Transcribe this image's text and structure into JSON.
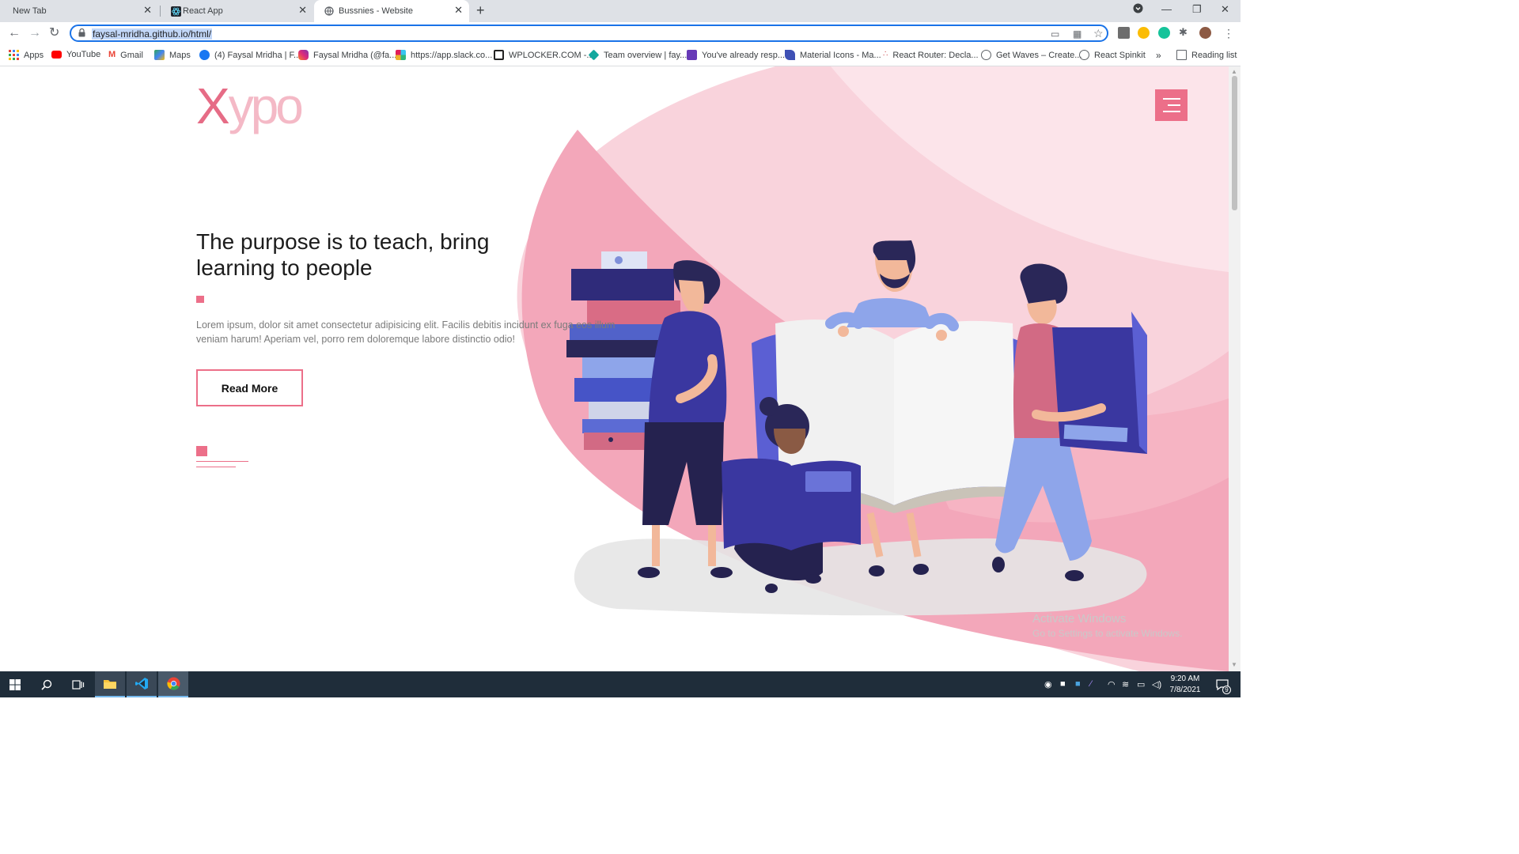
{
  "browser": {
    "tabs": [
      {
        "title": "New Tab",
        "active": false
      },
      {
        "title": "React App",
        "active": false
      },
      {
        "title": "Bussnies - Website",
        "active": true
      }
    ],
    "url": "faysal-mridha.github.io/html/",
    "bookmarks": [
      {
        "label": "Apps",
        "icon": "apps-grid-icon",
        "color": "#ea4335"
      },
      {
        "label": "YouTube",
        "icon": "youtube-icon",
        "color": "#ff0000"
      },
      {
        "label": "Gmail",
        "icon": "gmail-icon",
        "color": "#ea4335"
      },
      {
        "label": "Maps",
        "icon": "maps-icon",
        "color": "#34a853"
      },
      {
        "label": "(4) Faysal Mridha | F...",
        "icon": "facebook-icon",
        "color": "#1877f2"
      },
      {
        "label": "Faysal Mridha (@fa...",
        "icon": "instagram-icon",
        "color": "#c13584"
      },
      {
        "label": "https://app.slack.co...",
        "icon": "slack-icon",
        "color": "#4a154b"
      },
      {
        "label": "WPLOCKER.COM -...",
        "icon": "wplocker-icon",
        "color": "#222222"
      },
      {
        "label": "Team overview | fay...",
        "icon": "diamond-icon",
        "color": "#13a89e"
      },
      {
        "label": "You've already resp...",
        "icon": "forms-icon",
        "color": "#673ab7"
      },
      {
        "label": "Material Icons - Ma...",
        "icon": "material-icon",
        "color": "#3f51b5"
      },
      {
        "label": "React Router: Decla...",
        "icon": "react-router-icon",
        "color": "#ca4245"
      },
      {
        "label": "Get Waves – Create...",
        "icon": "globe-icon",
        "color": "#5f6368"
      },
      {
        "label": "React Spinkit",
        "icon": "globe-icon",
        "color": "#5f6368"
      }
    ],
    "bookmarks_overflow": "»",
    "reading_list": "Reading list"
  },
  "site": {
    "logo_first": "X",
    "logo_rest": "ypo",
    "headline": "The purpose is to teach, bring learning to people",
    "body": "Lorem ipsum, dolor sit amet consectetur adipisicing elit. Facilis debitis incidunt ex fuga eos illum veniam harum! Aperiam vel, porro rem doloremque labore distinctio odio!",
    "cta_label": "Read More",
    "accent_color": "#ec6f89"
  },
  "watermark": {
    "title": "Activate Windows",
    "subtitle": "Go to Settings to activate Windows."
  },
  "taskbar": {
    "time": "9:20 AM",
    "date": "7/8/2021",
    "notification_count": "9"
  }
}
